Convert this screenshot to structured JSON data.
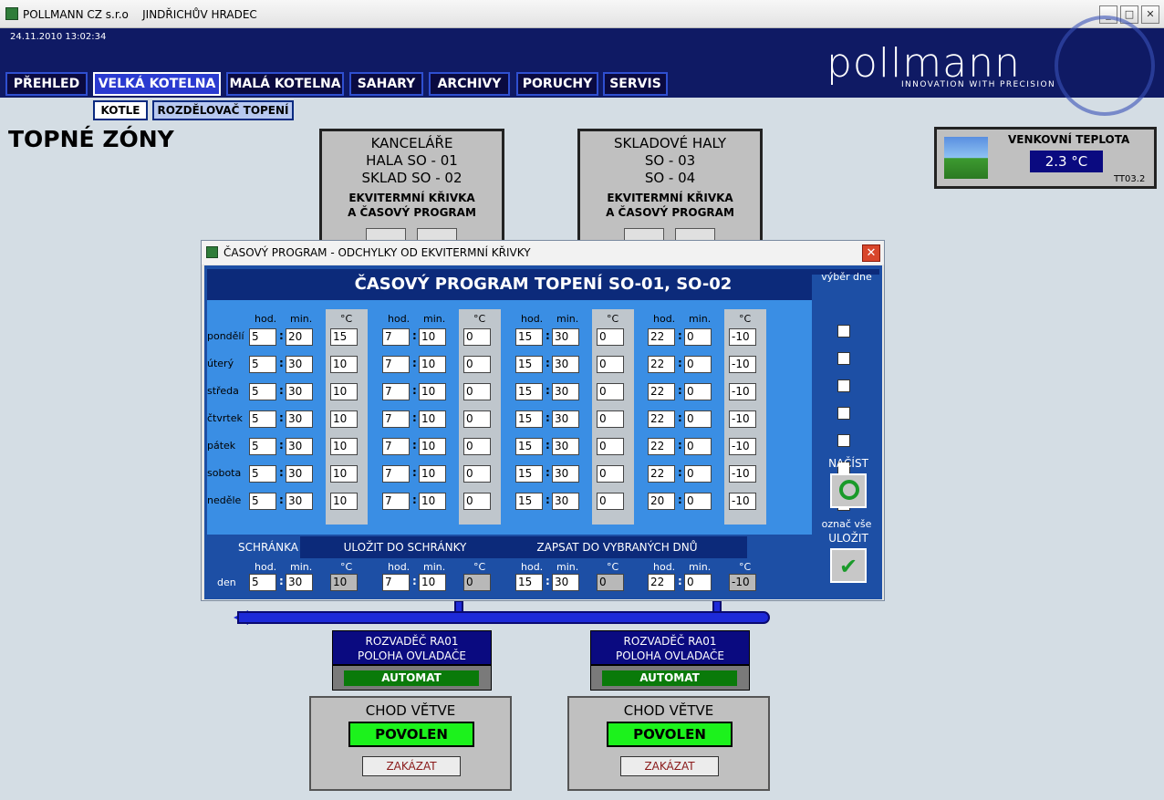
{
  "window": {
    "title": "POLLMANN CZ s.r.o    JINDŘICHŮV HRADEC",
    "minimize": "_",
    "maximize": "□",
    "close": "✕"
  },
  "header": {
    "datetime": "24.11.2010 13:02:34",
    "logo_text": "pollmann",
    "logo_tagline": "INNOVATION WITH PRECISION"
  },
  "nav": {
    "tabs": [
      {
        "label": "PŘEHLED"
      },
      {
        "label": "VELKÁ KOTELNA"
      },
      {
        "label": "MALÁ KOTELNA"
      },
      {
        "label": "SAHARY"
      },
      {
        "label": "ARCHIVY"
      },
      {
        "label": "PORUCHY"
      },
      {
        "label": "SERVIS"
      }
    ],
    "subtabs": [
      {
        "label": "KOTLE"
      },
      {
        "label": "ROZDĚLOVAČ TOPENÍ"
      }
    ]
  },
  "page_title": "TOPNÉ ZÓNY",
  "zones": [
    {
      "lines": [
        "KANCELÁŘE",
        "HALA SO - 01",
        "SKLAD SO - 02"
      ],
      "sub1": "EKVITERMNÍ KŘIVKA",
      "sub2": "A ČASOVÝ PROGRAM"
    },
    {
      "lines": [
        "SKLADOVÉ HALY",
        "SO - 03",
        "SO - 04"
      ],
      "sub1": "EKVITERMNÍ KŘIVKA",
      "sub2": "A ČASOVÝ PROGRAM"
    }
  ],
  "outside_temp": {
    "label": "VENKOVNÍ TEPLOTA",
    "value": "2.3 °C",
    "tag": "TT03.2"
  },
  "dialog": {
    "title": "ČASOVÝ PROGRAM - ODCHYLKY OD EKVITERMNÍ KŘIVKY",
    "heading": "ČASOVÝ PROGRAM TOPENÍ SO-01, SO-02",
    "col_hod": "hod.",
    "col_min": "min.",
    "col_deg": "°C",
    "select_day_label": "výběr dne",
    "mark_all_label": "označ vše",
    "load_label": "NAČÍST",
    "save_label": "ULOŽIT",
    "days": [
      {
        "name": "pondělí",
        "blocks": [
          [
            "5",
            "20",
            "15"
          ],
          [
            "7",
            "10",
            "0"
          ],
          [
            "15",
            "30",
            "0"
          ],
          [
            "22",
            "0",
            "-10"
          ]
        ]
      },
      {
        "name": "úterý",
        "blocks": [
          [
            "5",
            "30",
            "10"
          ],
          [
            "7",
            "10",
            "0"
          ],
          [
            "15",
            "30",
            "0"
          ],
          [
            "22",
            "0",
            "-10"
          ]
        ]
      },
      {
        "name": "středa",
        "blocks": [
          [
            "5",
            "30",
            "10"
          ],
          [
            "7",
            "10",
            "0"
          ],
          [
            "15",
            "30",
            "0"
          ],
          [
            "22",
            "0",
            "-10"
          ]
        ]
      },
      {
        "name": "čtvrtek",
        "blocks": [
          [
            "5",
            "30",
            "10"
          ],
          [
            "7",
            "10",
            "0"
          ],
          [
            "15",
            "30",
            "0"
          ],
          [
            "22",
            "0",
            "-10"
          ]
        ]
      },
      {
        "name": "pátek",
        "blocks": [
          [
            "5",
            "30",
            "10"
          ],
          [
            "7",
            "10",
            "0"
          ],
          [
            "15",
            "30",
            "0"
          ],
          [
            "22",
            "0",
            "-10"
          ]
        ]
      },
      {
        "name": "sobota",
        "blocks": [
          [
            "5",
            "30",
            "10"
          ],
          [
            "7",
            "10",
            "0"
          ],
          [
            "15",
            "30",
            "0"
          ],
          [
            "22",
            "0",
            "-10"
          ]
        ]
      },
      {
        "name": "neděle",
        "blocks": [
          [
            "5",
            "30",
            "10"
          ],
          [
            "7",
            "10",
            "0"
          ],
          [
            "15",
            "30",
            "0"
          ],
          [
            "20",
            "0",
            "-10"
          ]
        ]
      }
    ],
    "clipboard": {
      "tab_label": "SCHRÁNKA",
      "save_to_clipboard": "ULOŽIT DO SCHRÁNKY",
      "write_to_selected": "ZAPSAT DO VYBRANÝCH DNŮ",
      "row_label": "den",
      "blocks": [
        [
          "5",
          "30",
          "10"
        ],
        [
          "7",
          "10",
          "0"
        ],
        [
          "15",
          "30",
          "0"
        ],
        [
          "22",
          "0",
          "-10"
        ]
      ]
    }
  },
  "distributors": [
    {
      "line1": "ROZVADĚČ RA01",
      "line2": "POLOHA OVLADAČE",
      "mode": "AUTOMAT",
      "chod_title": "CHOD VĚTVE",
      "status": "POVOLEN",
      "disable": "ZAKÁZAT"
    },
    {
      "line1": "ROZVADĚČ RA01",
      "line2": "POLOHA OVLADAČE",
      "mode": "AUTOMAT",
      "chod_title": "CHOD VĚTVE",
      "status": "POVOLEN",
      "disable": "ZAKÁZAT"
    }
  ]
}
